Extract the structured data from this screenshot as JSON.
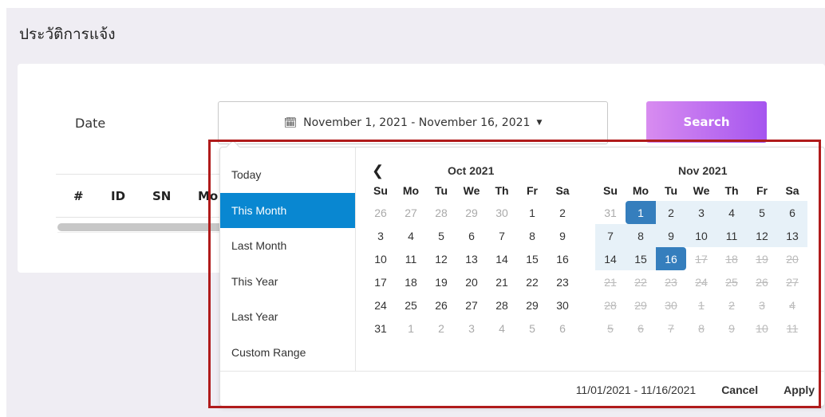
{
  "page": {
    "title": "ประวัติการแจ้ง"
  },
  "filter": {
    "date_label": "Date",
    "date_range_text": "November 1, 2021 - November 16, 2021",
    "calendar_icon": "calendar-icon",
    "caret_icon": "caret-down-icon",
    "search_label": "Search"
  },
  "table": {
    "columns": [
      "#",
      "ID",
      "SN",
      "Mo"
    ]
  },
  "picker": {
    "ranges": [
      "Today",
      "This Month",
      "Last Month",
      "This Year",
      "Last Year",
      "Custom Range"
    ],
    "active_range": "This Month",
    "weekdays": [
      "Su",
      "Mo",
      "Tu",
      "We",
      "Th",
      "Fr",
      "Sa"
    ],
    "left": {
      "title": "Oct 2021",
      "weeks": [
        [
          "26",
          "27",
          "28",
          "29",
          "30",
          "1",
          "2"
        ],
        [
          "3",
          "4",
          "5",
          "6",
          "7",
          "8",
          "9"
        ],
        [
          "10",
          "11",
          "12",
          "13",
          "14",
          "15",
          "16"
        ],
        [
          "17",
          "18",
          "19",
          "20",
          "21",
          "22",
          "23"
        ],
        [
          "24",
          "25",
          "26",
          "27",
          "28",
          "29",
          "30"
        ],
        [
          "31",
          "1",
          "2",
          "3",
          "4",
          "5",
          "6"
        ]
      ]
    },
    "right": {
      "title": "Nov 2021",
      "weeks": [
        [
          "31",
          "1",
          "2",
          "3",
          "4",
          "5",
          "6"
        ],
        [
          "7",
          "8",
          "9",
          "10",
          "11",
          "12",
          "13"
        ],
        [
          "14",
          "15",
          "16",
          "17",
          "18",
          "19",
          "20"
        ],
        [
          "21",
          "22",
          "23",
          "24",
          "25",
          "26",
          "27"
        ],
        [
          "28",
          "29",
          "30",
          "1",
          "2",
          "3",
          "4"
        ],
        [
          "5",
          "6",
          "7",
          "8",
          "9",
          "10",
          "11"
        ]
      ]
    },
    "selected_text": "11/01/2021 - 11/16/2021",
    "cancel_label": "Cancel",
    "apply_label": "Apply",
    "prev_icon": "chevron-left-icon"
  },
  "colors": {
    "accent": "#0987d1",
    "selected": "#357ebd",
    "in_range": "#e7f1f8",
    "highlight_border": "#b01b1b"
  }
}
